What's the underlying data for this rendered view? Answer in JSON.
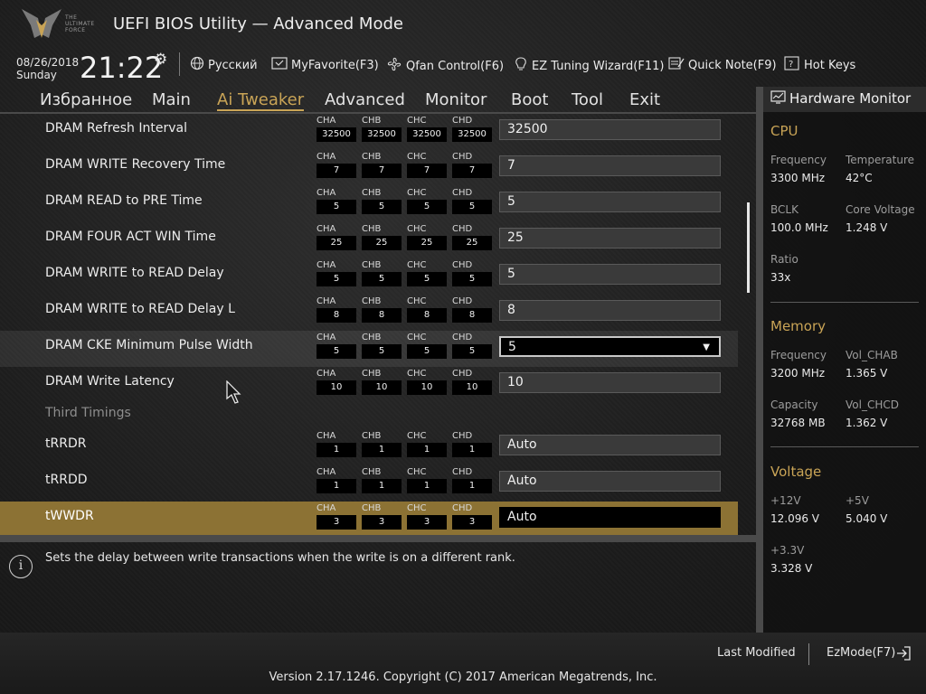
{
  "header": {
    "logo_text": "THE ULTIMATE FORCE",
    "title": "UEFI BIOS Utility — Advanced Mode",
    "date": "08/26/2018",
    "day": "Sunday",
    "time": "21:22",
    "language": "Русский",
    "myfavorite": "MyFavorite(F3)",
    "qfan": "Qfan Control(F6)",
    "ez_tuning": "EZ Tuning Wizard(F11)",
    "quick_note": "Quick Note(F9)",
    "hot_keys": "Hot Keys"
  },
  "tabs": [
    {
      "label": "Избранное"
    },
    {
      "label": "Main"
    },
    {
      "label": "Ai Tweaker",
      "active": true
    },
    {
      "label": "Advanced"
    },
    {
      "label": "Monitor"
    },
    {
      "label": "Boot"
    },
    {
      "label": "Tool"
    },
    {
      "label": "Exit"
    }
  ],
  "channels": [
    "CHA",
    "CHB",
    "CHC",
    "CHD"
  ],
  "rows": [
    {
      "label": "DRAM Refresh Interval",
      "ch": [
        "32500",
        "32500",
        "32500",
        "32500"
      ],
      "value": "32500"
    },
    {
      "label": "DRAM WRITE Recovery Time",
      "ch": [
        "7",
        "7",
        "7",
        "7"
      ],
      "value": "7"
    },
    {
      "label": "DRAM READ to PRE Time",
      "ch": [
        "5",
        "5",
        "5",
        "5"
      ],
      "value": "5"
    },
    {
      "label": "DRAM FOUR ACT WIN Time",
      "ch": [
        "25",
        "25",
        "25",
        "25"
      ],
      "value": "25"
    },
    {
      "label": "DRAM WRITE to READ Delay",
      "ch": [
        "5",
        "5",
        "5",
        "5"
      ],
      "value": "5"
    },
    {
      "label": "DRAM WRITE to READ Delay L",
      "ch": [
        "8",
        "8",
        "8",
        "8"
      ],
      "value": "8"
    },
    {
      "label": "DRAM CKE Minimum Pulse Width",
      "ch": [
        "5",
        "5",
        "5",
        "5"
      ],
      "value": "5"
    },
    {
      "label": "DRAM Write Latency",
      "ch": [
        "10",
        "10",
        "10",
        "10"
      ],
      "value": "10"
    }
  ],
  "section_third": "Third Timings",
  "rows2": [
    {
      "label": "tRRDR",
      "ch": [
        "1",
        "1",
        "1",
        "1"
      ],
      "value": "Auto"
    },
    {
      "label": "tRRDD",
      "ch": [
        "1",
        "1",
        "1",
        "1"
      ],
      "value": "Auto"
    },
    {
      "label": "tWWDR",
      "ch": [
        "3",
        "3",
        "3",
        "3"
      ],
      "value": "Auto"
    }
  ],
  "help_text": "Sets the delay between write transactions when the write is on a different rank.",
  "hw": {
    "title": "Hardware Monitor",
    "cpu": {
      "title": "CPU",
      "frequency_label": "Frequency",
      "frequency": "3300 MHz",
      "temperature_label": "Temperature",
      "temperature": "42°C",
      "bclk_label": "BCLK",
      "bclk": "100.0 MHz",
      "core_voltage_label": "Core Voltage",
      "core_voltage": "1.248 V",
      "ratio_label": "Ratio",
      "ratio": "33x"
    },
    "memory": {
      "title": "Memory",
      "frequency_label": "Frequency",
      "frequency": "3200 MHz",
      "vol_chab_label": "Vol_CHAB",
      "vol_chab": "1.365 V",
      "capacity_label": "Capacity",
      "capacity": "32768 MB",
      "vol_chcd_label": "Vol_CHCD",
      "vol_chcd": "1.362 V"
    },
    "voltage": {
      "title": "Voltage",
      "v12_label": "+12V",
      "v12": "12.096 V",
      "v5_label": "+5V",
      "v5": "5.040 V",
      "v33_label": "+3.3V",
      "v33": "3.328 V"
    }
  },
  "footer": {
    "last_modified": "Last Modified",
    "ez_mode": "EzMode(F7)",
    "version": "Version 2.17.1246. Copyright (C) 2017 American Megatrends, Inc."
  },
  "colors": {
    "accent": "#c9a456",
    "selected_row": "#8c7234"
  }
}
